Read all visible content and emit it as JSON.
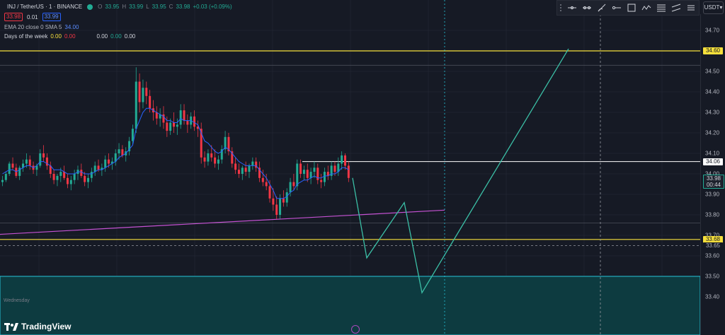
{
  "header": {
    "symbol": "INJ / TetherUS · 1 · BINANCE",
    "ohlc": {
      "o_label": "O",
      "o": "33.95",
      "h_label": "H",
      "h": "33.99",
      "l_label": "L",
      "l": "33.95",
      "c_label": "C",
      "c": "33.98",
      "change": "+0.03 (+0.09%)"
    },
    "bid": "33.98",
    "spread": "0.01",
    "ask": "33.99",
    "indicators": [
      {
        "name": "EMA 20 close 0 SMA 5",
        "values": [
          "34.00"
        ]
      },
      {
        "name": "Days of the week",
        "values": [
          "0.00",
          "0.00",
          "0.00",
          "0.00",
          "0.00"
        ]
      }
    ]
  },
  "toolbar": {
    "tools": [
      "horizontal-line-icon",
      "trend-line-icon",
      "brush-icon",
      "horizontal-ray-icon",
      "rectangle-icon",
      "path-icon",
      "fib-icon",
      "parallel-channel-icon",
      "long-position-icon"
    ],
    "currency": "USDT"
  },
  "colors": {
    "up": "#22ab94",
    "down": "#f23645",
    "ema": "#2962ff",
    "level": "#f7e03c",
    "projection": "#3bbfa6",
    "trendline": "#c552d3",
    "zone": "#0d3b40",
    "crosshair": "#26c6da"
  },
  "footer": {
    "brand": "TradingView",
    "day_label": "Wednesday"
  },
  "chart_data": {
    "type": "candlestick",
    "y_axis": {
      "ticks": [
        "34.70",
        "34.60",
        "34.50",
        "34.40",
        "34.30",
        "34.20",
        "34.10",
        "34.00",
        "33.90",
        "33.80",
        "33.70",
        "33.60",
        "33.50",
        "33.40"
      ],
      "range": [
        33.35,
        34.79
      ]
    },
    "price_tags": {
      "upper_level": "34.60",
      "resistance": "34.06",
      "last_price": "33.98",
      "countdown": "00:44",
      "lower_level": "33.68",
      "dashed_level": "33.65"
    },
    "levels": {
      "upper_yellow": 34.6,
      "resistance_white": 34.06,
      "lower_yellow": 33.68,
      "dashed": 33.65,
      "zone_top": 33.5,
      "grey_upper": 34.53,
      "grey_lower": 33.76
    },
    "trendline": [
      [
        0,
        33.705
      ],
      [
        628,
        33.823
      ]
    ],
    "projection_path": [
      [
        498,
        33.98
      ],
      [
        518,
        33.59
      ],
      [
        571,
        33.86
      ],
      [
        596,
        33.42
      ],
      [
        803,
        34.61
      ]
    ],
    "candles": [
      [
        33.96,
        33.99,
        33.94,
        33.97
      ],
      [
        33.97,
        34.01,
        33.96,
        34.0
      ],
      [
        34.0,
        34.06,
        33.99,
        34.05
      ],
      [
        34.05,
        34.08,
        34.02,
        34.03
      ],
      [
        34.03,
        34.05,
        33.98,
        33.99
      ],
      [
        33.99,
        34.04,
        33.97,
        34.03
      ],
      [
        34.03,
        34.07,
        34.01,
        34.05
      ],
      [
        34.05,
        34.1,
        34.03,
        34.07
      ],
      [
        34.07,
        34.09,
        34.02,
        34.04
      ],
      [
        34.04,
        34.06,
        34.0,
        34.02
      ],
      [
        34.02,
        34.05,
        33.99,
        34.04
      ],
      [
        34.04,
        34.12,
        34.03,
        34.1
      ],
      [
        34.1,
        34.14,
        34.06,
        34.08
      ],
      [
        34.08,
        34.1,
        34.02,
        34.04
      ],
      [
        34.04,
        34.06,
        33.98,
        34.0
      ],
      [
        34.0,
        34.02,
        33.95,
        33.97
      ],
      [
        33.97,
        34.0,
        33.94,
        33.99
      ],
      [
        33.99,
        34.03,
        33.96,
        34.01
      ],
      [
        34.01,
        34.04,
        33.97,
        33.98
      ],
      [
        33.98,
        34.0,
        33.93,
        33.95
      ],
      [
        33.95,
        33.99,
        33.92,
        33.97
      ],
      [
        33.97,
        34.02,
        33.95,
        34.0
      ],
      [
        34.0,
        34.04,
        33.97,
        34.02
      ],
      [
        34.02,
        34.05,
        33.98,
        33.99
      ],
      [
        33.99,
        34.01,
        33.94,
        33.96
      ],
      [
        33.96,
        34.0,
        33.93,
        33.98
      ],
      [
        33.98,
        34.03,
        33.96,
        34.01
      ],
      [
        34.01,
        34.06,
        33.99,
        34.04
      ],
      [
        34.04,
        34.07,
        34.01,
        34.02
      ],
      [
        34.02,
        34.05,
        33.99,
        34.03
      ],
      [
        34.03,
        34.09,
        34.01,
        34.07
      ],
      [
        34.07,
        34.1,
        34.03,
        34.05
      ],
      [
        34.05,
        34.08,
        34.02,
        34.06
      ],
      [
        34.06,
        34.12,
        34.04,
        34.1
      ],
      [
        34.1,
        34.15,
        34.07,
        34.12
      ],
      [
        34.12,
        34.14,
        34.08,
        34.09
      ],
      [
        34.09,
        34.13,
        34.06,
        34.11
      ],
      [
        34.11,
        34.18,
        34.09,
        34.16
      ],
      [
        34.16,
        34.24,
        34.14,
        34.22
      ],
      [
        34.22,
        34.52,
        34.2,
        34.45
      ],
      [
        34.45,
        34.49,
        34.3,
        34.35
      ],
      [
        34.35,
        34.46,
        34.32,
        34.42
      ],
      [
        34.42,
        34.45,
        34.34,
        34.38
      ],
      [
        34.38,
        34.41,
        34.3,
        34.32
      ],
      [
        34.32,
        34.36,
        34.26,
        34.3
      ],
      [
        34.3,
        34.33,
        34.24,
        34.27
      ],
      [
        34.27,
        34.32,
        34.23,
        34.29
      ],
      [
        34.29,
        34.33,
        34.22,
        34.25
      ],
      [
        34.25,
        34.28,
        34.18,
        34.21
      ],
      [
        34.21,
        34.27,
        34.19,
        34.25
      ],
      [
        34.25,
        34.3,
        34.2,
        34.23
      ],
      [
        34.23,
        34.27,
        34.19,
        34.24
      ],
      [
        34.24,
        34.34,
        34.22,
        34.31
      ],
      [
        34.31,
        34.34,
        34.24,
        34.26
      ],
      [
        34.26,
        34.29,
        34.2,
        34.24
      ],
      [
        34.24,
        34.3,
        34.22,
        34.28
      ],
      [
        34.28,
        34.31,
        34.21,
        34.23
      ],
      [
        34.23,
        34.26,
        34.18,
        34.22
      ],
      [
        34.22,
        34.25,
        34.05,
        34.08
      ],
      [
        34.08,
        34.11,
        34.03,
        34.06
      ],
      [
        34.06,
        34.12,
        34.04,
        34.1
      ],
      [
        34.1,
        34.14,
        34.06,
        34.08
      ],
      [
        34.08,
        34.12,
        34.03,
        34.05
      ],
      [
        34.05,
        34.09,
        34.02,
        34.07
      ],
      [
        34.07,
        34.14,
        34.05,
        34.12
      ],
      [
        34.12,
        34.21,
        34.1,
        34.18
      ],
      [
        34.18,
        34.2,
        34.09,
        34.11
      ],
      [
        34.11,
        34.13,
        34.03,
        34.05
      ],
      [
        34.05,
        34.08,
        34.0,
        34.02
      ],
      [
        34.02,
        34.05,
        33.98,
        34.0
      ],
      [
        34.0,
        34.04,
        33.97,
        34.03
      ],
      [
        34.03,
        34.06,
        33.99,
        34.01
      ],
      [
        34.01,
        34.05,
        33.98,
        34.04
      ],
      [
        34.04,
        34.08,
        34.02,
        34.06
      ],
      [
        34.06,
        34.08,
        34.01,
        34.03
      ],
      [
        34.03,
        34.06,
        33.96,
        33.98
      ],
      [
        33.98,
        34.02,
        33.94,
        33.96
      ],
      [
        33.96,
        34.0,
        33.92,
        33.94
      ],
      [
        33.94,
        33.97,
        33.86,
        33.88
      ],
      [
        33.88,
        33.93,
        33.82,
        33.85
      ],
      [
        33.85,
        33.89,
        33.78,
        33.8
      ],
      [
        33.8,
        33.9,
        33.78,
        33.88
      ],
      [
        33.88,
        33.92,
        33.84,
        33.86
      ],
      [
        33.86,
        33.93,
        33.84,
        33.91
      ],
      [
        33.91,
        33.98,
        33.89,
        33.96
      ],
      [
        33.96,
        34.0,
        33.92,
        33.94
      ],
      [
        33.94,
        34.07,
        33.92,
        34.05
      ],
      [
        34.05,
        34.07,
        33.98,
        34.0
      ],
      [
        34.0,
        34.04,
        33.97,
        34.02
      ],
      [
        34.02,
        34.05,
        33.96,
        33.98
      ],
      [
        33.98,
        34.03,
        33.95,
        34.01
      ],
      [
        34.01,
        34.06,
        33.98,
        34.03
      ],
      [
        34.03,
        34.05,
        33.95,
        33.97
      ],
      [
        33.97,
        34.0,
        33.93,
        33.96
      ],
      [
        33.96,
        34.03,
        33.94,
        34.01
      ],
      [
        34.01,
        34.04,
        33.97,
        33.99
      ],
      [
        33.99,
        34.06,
        33.97,
        34.04
      ],
      [
        34.04,
        34.06,
        33.99,
        34.01
      ],
      [
        34.01,
        34.08,
        33.99,
        34.05
      ],
      [
        34.05,
        34.11,
        34.02,
        34.09
      ],
      [
        34.09,
        34.1,
        34.02,
        34.04
      ],
      [
        34.04,
        34.06,
        33.96,
        33.98
      ]
    ],
    "ema": [
      34.0,
      34.01,
      34.02,
      34.02,
      34.01,
      34.02,
      34.03,
      34.04,
      34.04,
      34.03,
      34.04,
      34.06,
      34.06,
      34.05,
      34.04,
      34.02,
      34.02,
      34.02,
      34.01,
      34.0,
      34.0,
      34.0,
      34.01,
      34.01,
      34.0,
      34.0,
      34.0,
      34.01,
      34.02,
      34.02,
      34.03,
      34.04,
      34.05,
      34.06,
      34.08,
      34.09,
      34.1,
      34.12,
      34.14,
      34.22,
      34.26,
      34.3,
      34.32,
      34.32,
      34.31,
      34.3,
      34.29,
      34.28,
      34.26,
      34.26,
      34.25,
      34.25,
      34.27,
      34.26,
      34.26,
      34.26,
      34.25,
      34.24,
      34.2,
      34.16,
      34.15,
      34.13,
      34.11,
      34.1,
      34.11,
      34.13,
      34.12,
      34.1,
      34.08,
      34.06,
      34.05,
      34.04,
      34.04,
      34.04,
      34.04,
      34.02,
      34.0,
      33.98,
      33.95,
      33.92,
      33.88,
      33.88,
      33.88,
      33.89,
      33.91,
      33.92,
      33.95,
      33.96,
      33.97,
      33.97,
      33.98,
      33.99,
      33.98,
      33.98,
      33.99,
      33.99,
      34.0,
      34.0,
      34.01,
      34.03,
      34.03,
      34.02
    ]
  }
}
